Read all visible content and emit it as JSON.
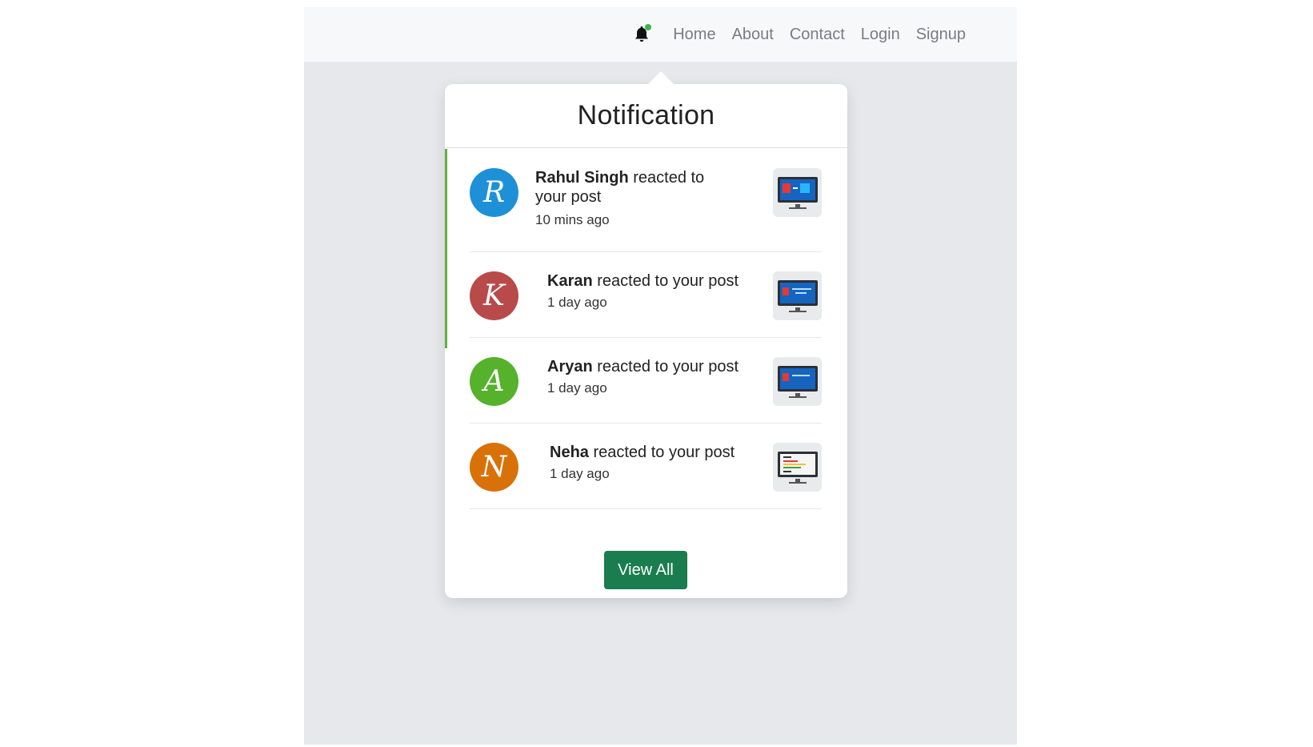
{
  "nav": {
    "items": [
      "Home",
      "About",
      "Contact",
      "Login",
      "Signup"
    ]
  },
  "panel": {
    "title": "Notification",
    "view_all_label": "View All",
    "notifications": [
      {
        "name": "Rahul Singh",
        "action": " reacted to your post",
        "time": "10 mins ago",
        "initial": "R",
        "avatar_color": "#1e90d8",
        "thumb_icon": "monitor-icon",
        "unread": true
      },
      {
        "name": "Karan",
        "action": " reacted to your post",
        "time": "1 day ago",
        "initial": "K",
        "avatar_color": "#b94a4a",
        "thumb_icon": "monitor-icon",
        "unread": true
      },
      {
        "name": "Aryan",
        "action": " reacted to your post",
        "time": "1 day ago",
        "initial": "A",
        "avatar_color": "#55b22a",
        "thumb_icon": "monitor-icon",
        "unread": false
      },
      {
        "name": "Neha",
        "action": " reacted to your post",
        "time": "1 day ago",
        "initial": "N",
        "avatar_color": "#d87208",
        "thumb_icon": "code-monitor-icon",
        "unread": false
      }
    ]
  },
  "colors": {
    "accent_unread": "#5fb33a",
    "button": "#1a7d4f",
    "bell_dot": "#3bb54a"
  }
}
